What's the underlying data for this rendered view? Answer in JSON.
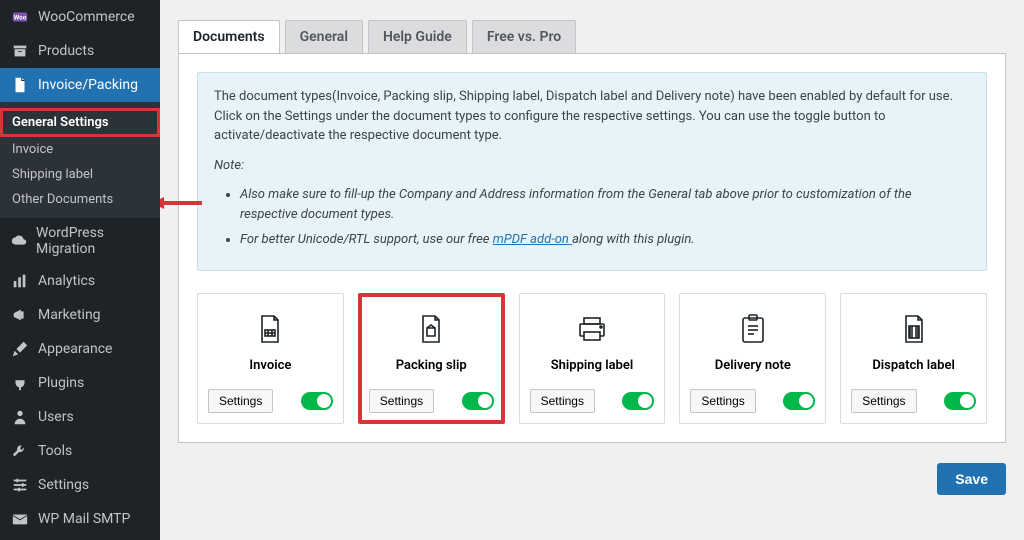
{
  "sidebar": {
    "items": [
      {
        "label": "WooCommerce",
        "icon": "woo"
      },
      {
        "label": "Products",
        "icon": "archive"
      },
      {
        "label": "Invoice/Packing",
        "icon": "file",
        "active": true,
        "submenu": [
          {
            "label": "General Settings",
            "highlight": true
          },
          {
            "label": "Invoice"
          },
          {
            "label": "Shipping label"
          },
          {
            "label": "Other Documents"
          }
        ]
      },
      {
        "label": "WordPress Migration",
        "icon": "cloud"
      },
      {
        "label": "Analytics",
        "icon": "chart"
      },
      {
        "label": "Marketing",
        "icon": "megaphone"
      },
      {
        "label": "Appearance",
        "icon": "brush"
      },
      {
        "label": "Plugins",
        "icon": "plug"
      },
      {
        "label": "Users",
        "icon": "user"
      },
      {
        "label": "Tools",
        "icon": "wrench"
      },
      {
        "label": "Settings",
        "icon": "sliders"
      },
      {
        "label": "WP Mail SMTP",
        "icon": "mail"
      }
    ]
  },
  "tabs": [
    {
      "label": "Documents",
      "active": true
    },
    {
      "label": "General"
    },
    {
      "label": "Help Guide"
    },
    {
      "label": "Free vs. Pro"
    }
  ],
  "notice": {
    "intro": "The document types(Invoice, Packing slip, Shipping label, Dispatch label and Delivery note) have been enabled by default for use. Click on the Settings under the document types to configure the respective settings. You can use the toggle button to activate/deactivate the respective document type.",
    "note_label": "Note:",
    "bullet1": "Also make sure to fill-up the Company and Address information from the General tab above prior to customization of the respective document types.",
    "bullet2_pre": "For better Unicode/RTL support, use our free ",
    "bullet2_link": "mPDF add-on ",
    "bullet2_post": "along with this plugin."
  },
  "docs": [
    {
      "title": "Invoice",
      "settings": "Settings"
    },
    {
      "title": "Packing slip",
      "settings": "Settings",
      "highlight": true
    },
    {
      "title": "Shipping label",
      "settings": "Settings"
    },
    {
      "title": "Delivery note",
      "settings": "Settings"
    },
    {
      "title": "Dispatch label",
      "settings": "Settings"
    }
  ],
  "save_label": "Save"
}
